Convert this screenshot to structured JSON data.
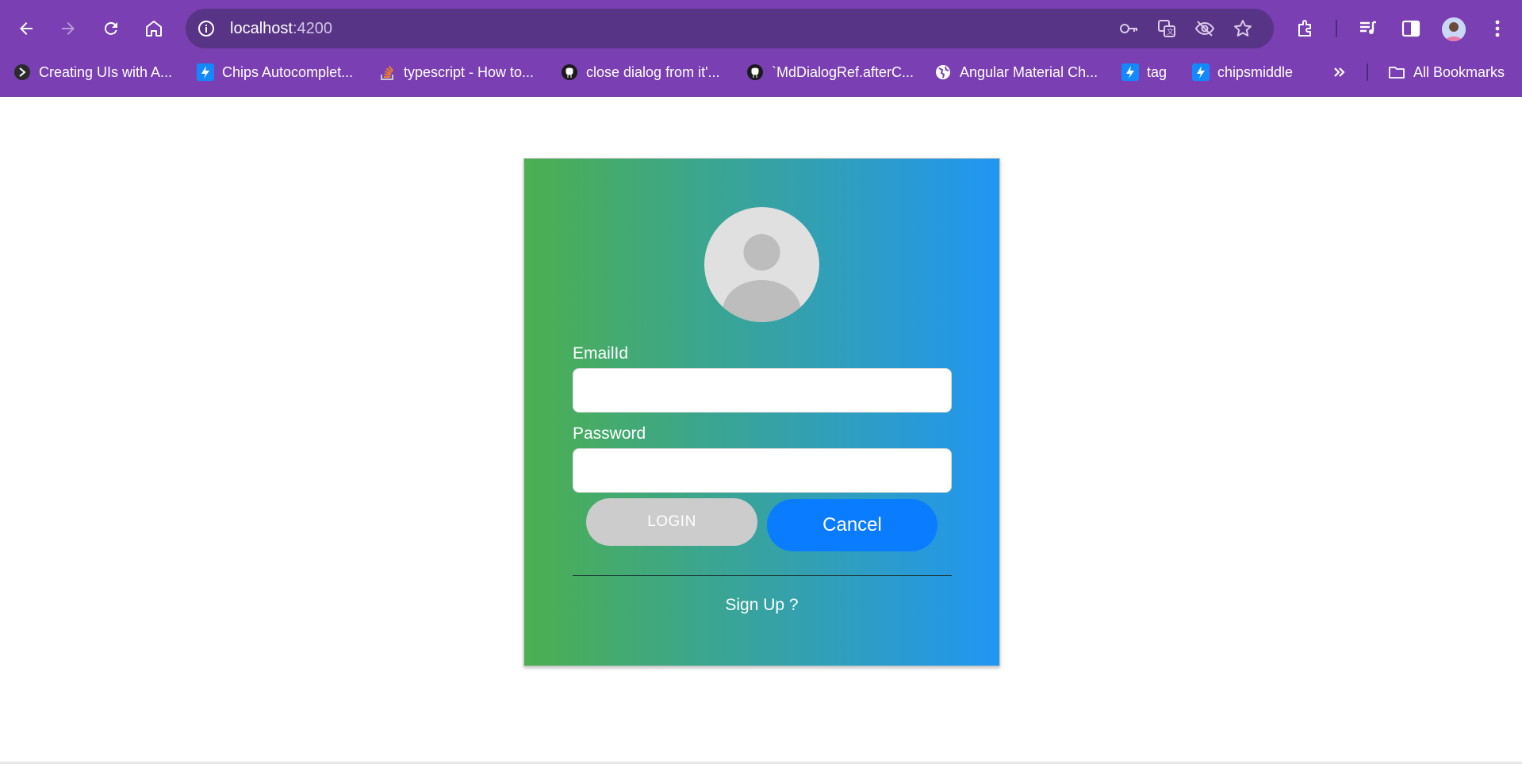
{
  "browser": {
    "url_host": "localhost",
    "url_port": ":4200",
    "bookmarks": [
      {
        "label": "Creating UIs with A...",
        "icon": "app-logo-icon"
      },
      {
        "label": "Chips Autocomplet...",
        "icon": "stackblitz-icon"
      },
      {
        "label": "typescript - How to...",
        "icon": "stackoverflow-icon"
      },
      {
        "label": "close dialog from it'...",
        "icon": "github-icon"
      },
      {
        "label": "`MdDialogRef.afterC...",
        "icon": "github-icon"
      },
      {
        "label": "Angular Material Ch...",
        "icon": "globe-icon"
      },
      {
        "label": "tag",
        "icon": "stackblitz-icon"
      },
      {
        "label": "chipsmiddle",
        "icon": "stackblitz-icon"
      }
    ],
    "all_bookmarks_label": "All Bookmarks",
    "chrome_color": "#7a3fb3"
  },
  "login": {
    "email_label": "EmailId",
    "email_value": "",
    "password_label": "Password",
    "password_value": "",
    "login_label": "LOGIN",
    "cancel_label": "Cancel",
    "signup_label": "Sign Up ?",
    "gradient_start": "#4caf50",
    "gradient_end": "#2196f3"
  }
}
